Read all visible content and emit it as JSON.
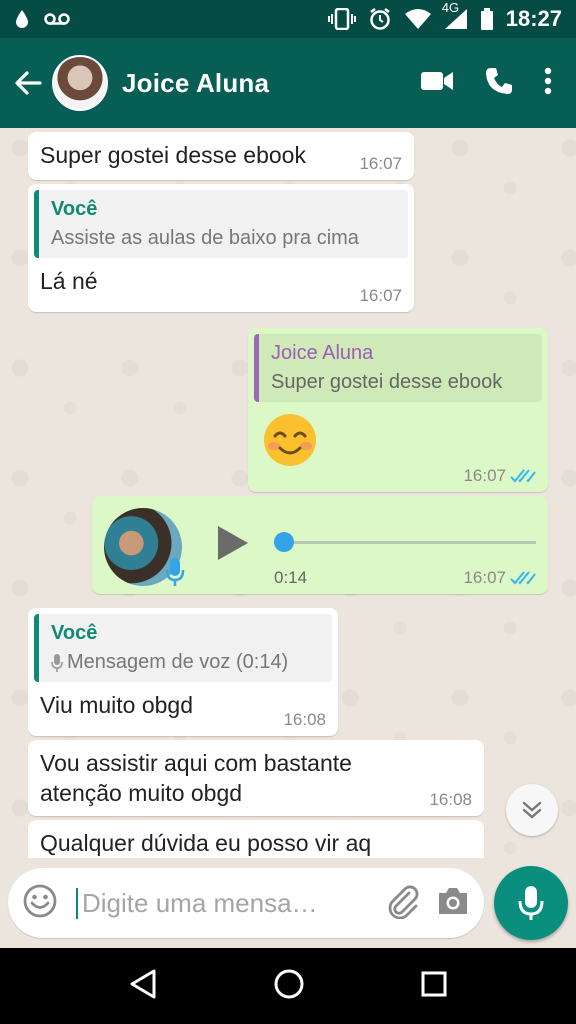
{
  "status_bar": {
    "time": "18:27",
    "network": "4G",
    "icons": [
      "drop-icon",
      "voicemail-icon",
      "vibrate-icon",
      "alarm-icon",
      "wifi-icon",
      "signal-icon",
      "battery-icon"
    ]
  },
  "header": {
    "contact_name": "Joice Aluna",
    "icons": [
      "back-arrow-icon",
      "video-call-icon",
      "phone-icon",
      "more-icon"
    ]
  },
  "messages": [
    {
      "dir": "in",
      "text": "Super gostei desse ebook",
      "time": "16:07"
    },
    {
      "dir": "in",
      "quote": {
        "author": "Você",
        "text": "Assiste as aulas de baixo pra cima"
      },
      "text": "Lá né",
      "time": "16:07"
    },
    {
      "dir": "out",
      "quote": {
        "author": "Joice Aluna",
        "text": "Super gostei desse ebook"
      },
      "text": "☺️",
      "time": "16:07"
    },
    {
      "dir": "out",
      "type": "voice",
      "duration": "0:14",
      "time": "16:07"
    },
    {
      "dir": "in",
      "quote": {
        "author": "Você",
        "text": "Mensagem de voz (0:14)"
      },
      "text": "Viu muito obgd",
      "time": "16:08"
    },
    {
      "dir": "in",
      "text_lines": [
        "Vou assistir aqui com bastante",
        "atenção muito obgd"
      ],
      "time": "16:08"
    },
    {
      "dir": "in",
      "text": "Qualquer dúvida eu posso vir aq",
      "time": ""
    }
  ],
  "composer": {
    "placeholder": "Digite uma mensa…"
  },
  "colors": {
    "header": "#075e54",
    "status_bar": "#054d44",
    "outgoing_bubble": "#dcf8c6",
    "chat_background": "#ece5dd",
    "accent": "#0a8f7e",
    "read_ticks": "#34b7f1"
  }
}
